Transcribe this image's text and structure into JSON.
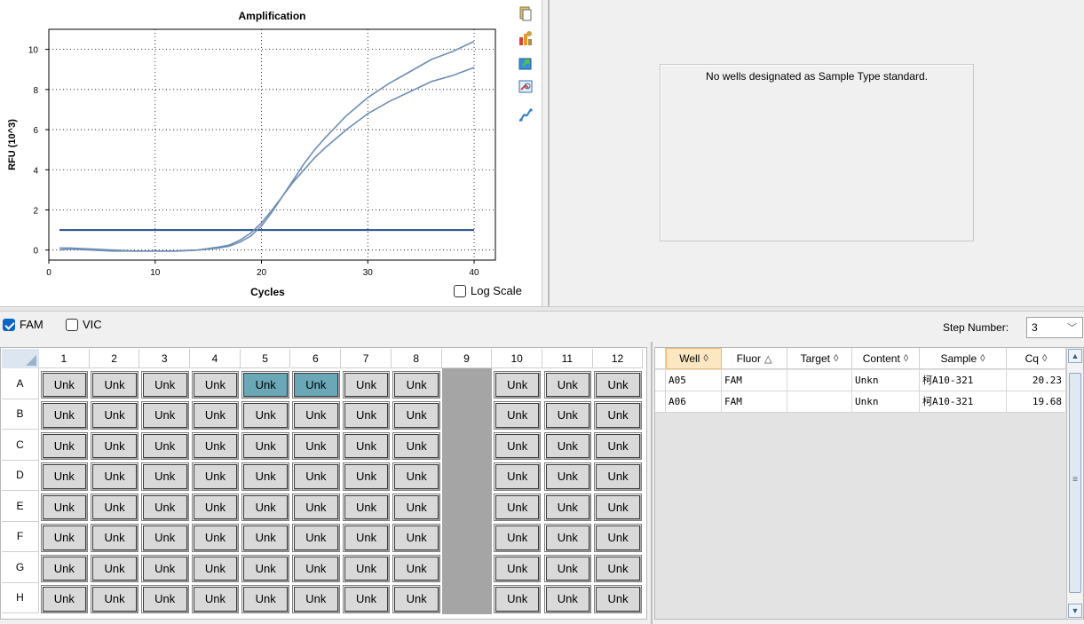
{
  "chart_data": {
    "type": "line",
    "title": "Amplification",
    "xlabel": "Cycles",
    "ylabel": "RFU (10^3)",
    "xlim": [
      0,
      42
    ],
    "ylim": [
      -0.5,
      11
    ],
    "xticks": [
      0,
      10,
      20,
      30,
      40
    ],
    "yticks": [
      0,
      2,
      4,
      6,
      8,
      10
    ],
    "grid": "dotted",
    "threshold": 1.0,
    "series": [
      {
        "well": "A05",
        "x": [
          1,
          2,
          4,
          6,
          8,
          10,
          12,
          14,
          16,
          17,
          18,
          19,
          20,
          21,
          22,
          23,
          24,
          25,
          26,
          28,
          30,
          32,
          34,
          36,
          38,
          40
        ],
        "y": [
          0.0,
          0.05,
          0.0,
          -0.05,
          -0.05,
          -0.05,
          -0.05,
          0.0,
          0.1,
          0.2,
          0.4,
          0.7,
          1.2,
          1.9,
          2.7,
          3.5,
          4.3,
          5.0,
          5.6,
          6.7,
          7.6,
          8.3,
          8.9,
          9.5,
          9.9,
          10.4
        ]
      },
      {
        "well": "A06",
        "x": [
          1,
          2,
          4,
          6,
          8,
          10,
          12,
          14,
          16,
          17,
          18,
          19,
          20,
          21,
          22,
          23,
          24,
          25,
          26,
          28,
          30,
          32,
          34,
          36,
          38,
          40
        ],
        "y": [
          0.1,
          0.1,
          0.05,
          0.0,
          -0.05,
          -0.05,
          -0.05,
          0.0,
          0.15,
          0.25,
          0.5,
          0.85,
          1.35,
          2.0,
          2.7,
          3.4,
          4.0,
          4.6,
          5.1,
          6.0,
          6.8,
          7.4,
          7.9,
          8.4,
          8.7,
          9.1
        ]
      }
    ]
  },
  "log_scale": {
    "label": "Log Scale",
    "checked": false
  },
  "standard_curve": {
    "message": "No wells designated as Sample Type standard."
  },
  "fluors": [
    {
      "label": "FAM",
      "checked": true
    },
    {
      "label": "VIC",
      "checked": false
    }
  ],
  "step": {
    "label": "Step Number:",
    "value": "3"
  },
  "plate": {
    "columns": [
      "1",
      "2",
      "3",
      "4",
      "5",
      "6",
      "7",
      "8",
      "9",
      "10",
      "11",
      "12"
    ],
    "rows": [
      "A",
      "B",
      "C",
      "D",
      "E",
      "F",
      "G",
      "H"
    ],
    "well_label": "Unk",
    "empty_column": "9",
    "selected": [
      "A5",
      "A6"
    ]
  },
  "results": {
    "headers": [
      {
        "label": "Well",
        "sort": "◊",
        "active": true
      },
      {
        "label": "Fluor",
        "sort": "△"
      },
      {
        "label": "Target",
        "sort": "◊"
      },
      {
        "label": "Content",
        "sort": "◊"
      },
      {
        "label": "Sample",
        "sort": "◊"
      },
      {
        "label": "Cq",
        "sort": "◊"
      }
    ],
    "rows": [
      {
        "well": "A05",
        "fluor": "FAM",
        "target": "",
        "content": "Unkn",
        "sample": "柯A10-321",
        "cq": "20.23"
      },
      {
        "well": "A06",
        "fluor": "FAM",
        "target": "",
        "content": "Unkn",
        "sample": "柯A10-321",
        "cq": "19.68"
      }
    ]
  },
  "colors": {
    "curve": "#6d8db5",
    "threshold": "#1f4e8c",
    "selected_well": "#6aa8b8"
  }
}
